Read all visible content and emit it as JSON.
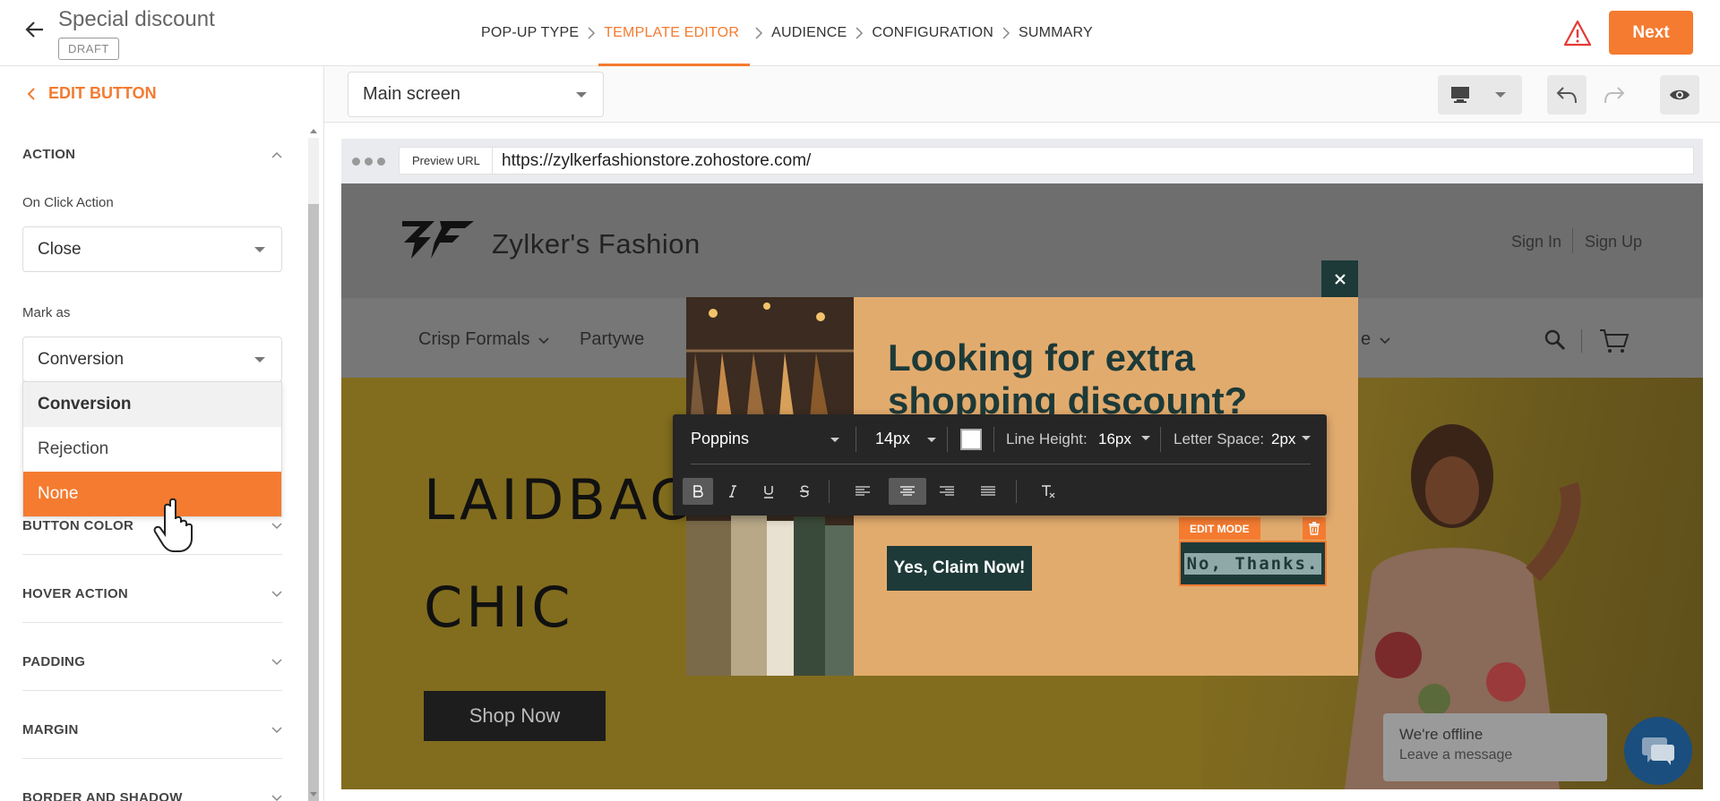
{
  "header": {
    "title": "Special discount",
    "status": "DRAFT",
    "steps": [
      {
        "label": "POP-UP TYPE",
        "active": false
      },
      {
        "label": "TEMPLATE EDITOR",
        "active": true
      },
      {
        "label": "AUDIENCE",
        "active": false
      },
      {
        "label": "CONFIGURATION",
        "active": false
      },
      {
        "label": "SUMMARY",
        "active": false
      }
    ],
    "next_label": "Next",
    "accent": "#f47b30"
  },
  "left_panel": {
    "back_label": "EDIT BUTTON",
    "action_section": "ACTION",
    "on_click_label": "On Click Action",
    "on_click_value": "Close",
    "mark_as_label": "Mark as",
    "mark_as_value": "Conversion",
    "mark_as_options": [
      "Conversion",
      "Rejection",
      "None"
    ],
    "mark_as_selected": "Conversion",
    "mark_as_hovered": "None",
    "sections": [
      "BUTTON COLOR",
      "HOVER ACTION",
      "PADDING",
      "MARGIN",
      "BORDER AND SHADOW"
    ]
  },
  "canvas": {
    "screen_value": "Main screen",
    "device_icon": "desktop-icon",
    "preview_url_label": "Preview URL",
    "preview_url": "https://zylkerfashionstore.zohostore.com/"
  },
  "site": {
    "brand": "Zylker's Fashion",
    "sign_in": "Sign In",
    "sign_up": "Sign Up",
    "nav": [
      "Crisp Formals",
      "Partywe",
      "e"
    ],
    "hero_line1": "LAIDBACK",
    "hero_line2": "CHIC",
    "shop_now": "Shop Now",
    "chat_title": "We're offline",
    "chat_sub": "Leave a message"
  },
  "popup": {
    "headline_line1": "Looking for extra",
    "headline_line2": "shopping discount?",
    "yes_label": "Yes, Claim Now!",
    "no_label": "No, Thanks.",
    "edit_mode_label": "EDIT MODE",
    "bg_color": "#e2ab6e",
    "dark_color": "#1d3a38"
  },
  "text_toolbar": {
    "font": "Poppins",
    "size": "14px",
    "color_swatch": "#ffffff",
    "line_height_label": "Line Height:",
    "line_height": "16px",
    "letter_space_label": "Letter Space:",
    "letter_space": "2px"
  }
}
